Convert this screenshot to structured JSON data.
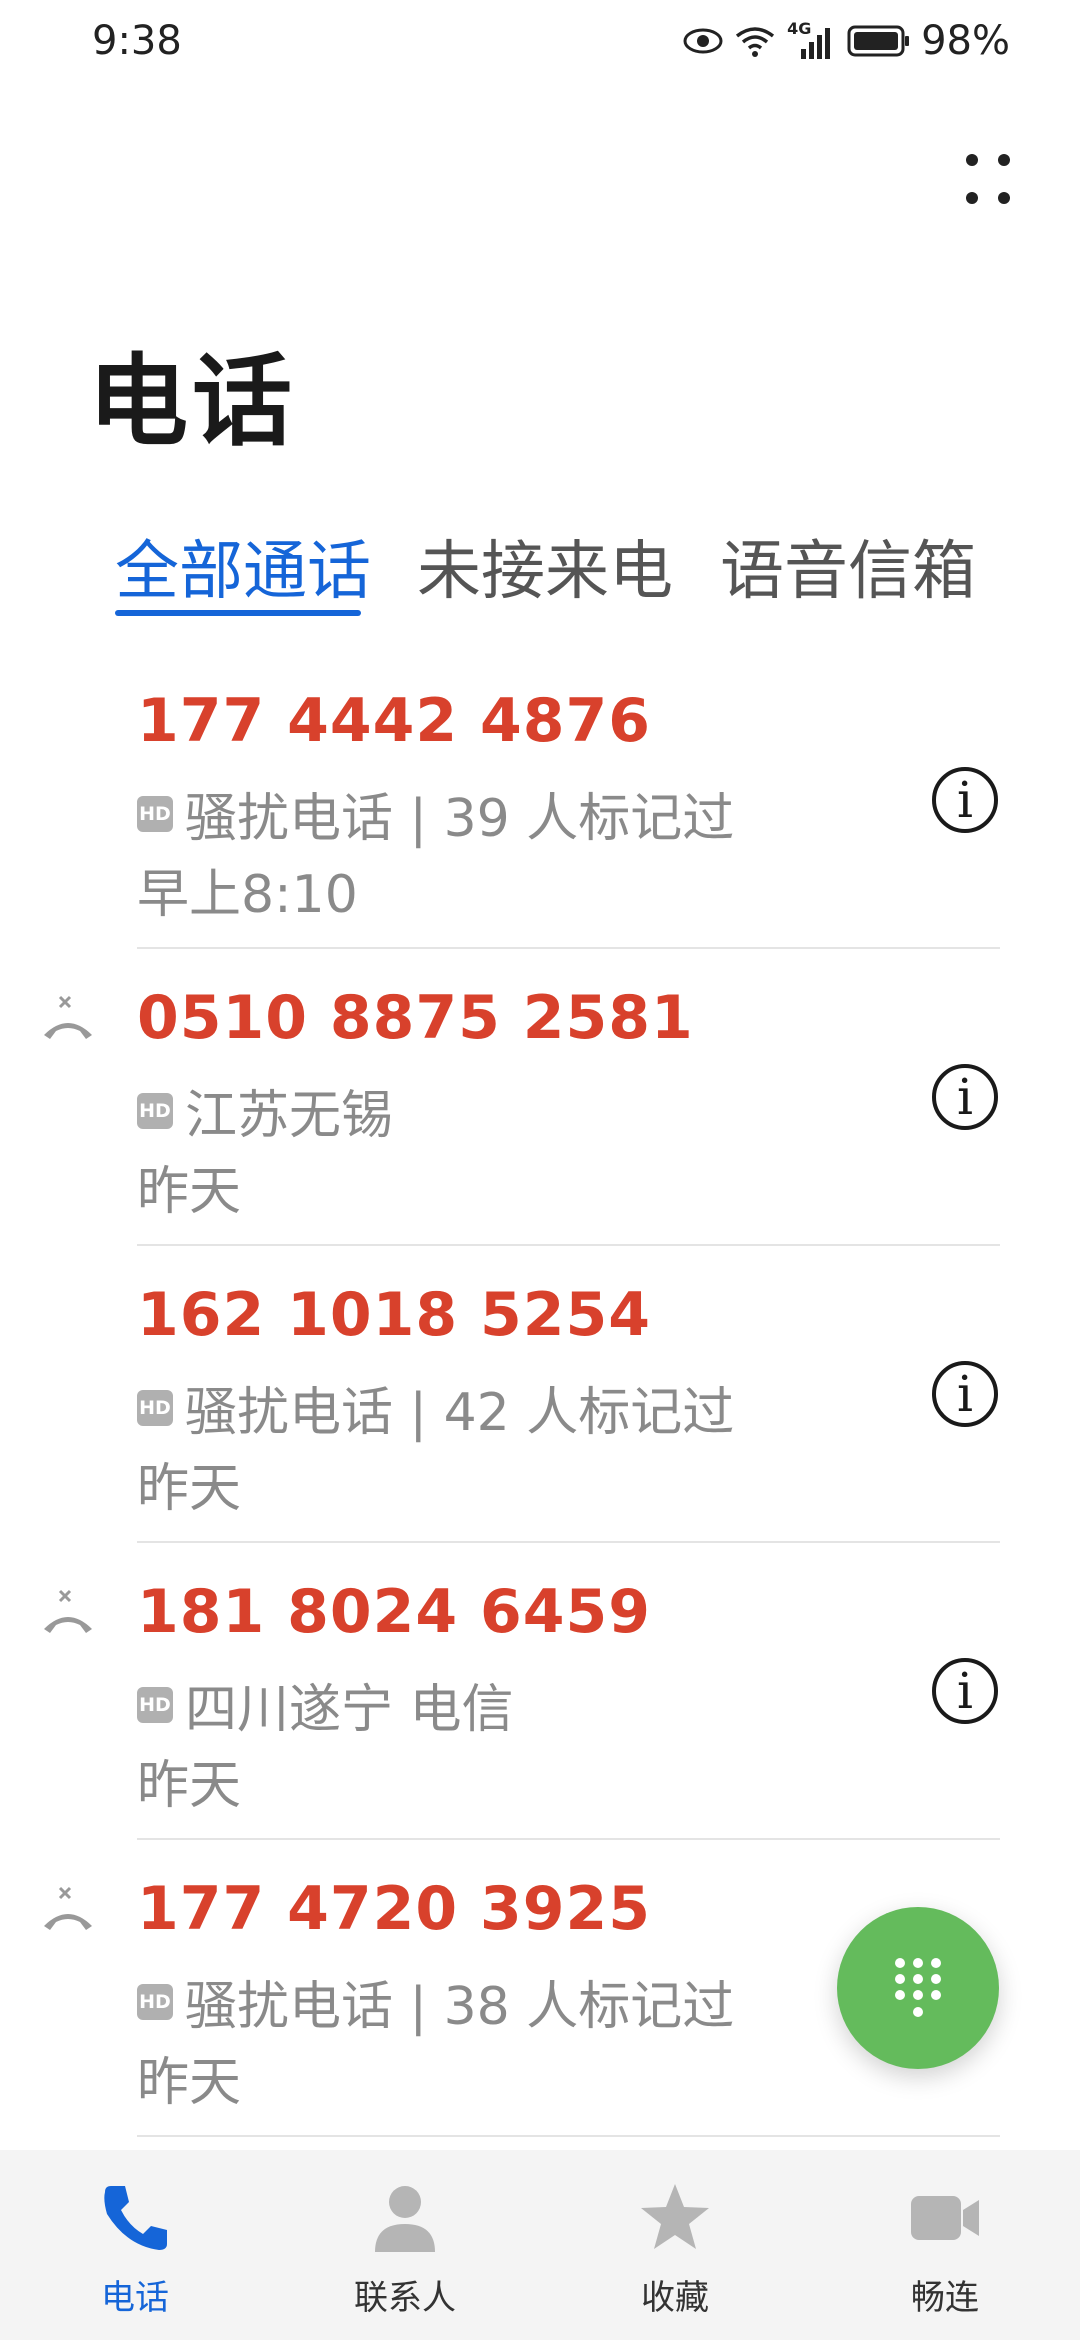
{
  "status_bar": {
    "time": "9:38",
    "network": "4G",
    "battery": "98%"
  },
  "header": {
    "title": "电话"
  },
  "tabs": [
    {
      "label": "全部通话",
      "active": true
    },
    {
      "label": "未接来电",
      "active": false
    },
    {
      "label": "语音信箱",
      "active": false
    }
  ],
  "calls": [
    {
      "number": "177 4442 4876",
      "hd": "HD",
      "detail": "骚扰电话 | 39 人标记过",
      "time": "早上8:10",
      "missed": false
    },
    {
      "number": "0510 8875 2581",
      "hd": "HD",
      "detail": "江苏无锡",
      "time": "昨天",
      "missed": true
    },
    {
      "number": "162 1018 5254",
      "hd": "HD",
      "detail": "骚扰电话 | 42 人标记过",
      "time": "昨天",
      "missed": false
    },
    {
      "number": "181 8024 6459",
      "hd": "HD",
      "detail": "四川遂宁 电信",
      "time": "昨天",
      "missed": true
    },
    {
      "number": "177 4720 3925",
      "hd": "HD",
      "detail": "骚扰电话 | 38 人标记过",
      "time": "昨天",
      "missed": true
    }
  ],
  "bottom_nav": [
    {
      "label": "电话",
      "icon": "phone-icon",
      "active": true
    },
    {
      "label": "联系人",
      "icon": "person-icon",
      "active": false
    },
    {
      "label": "收藏",
      "icon": "star-icon",
      "active": false
    },
    {
      "label": "畅连",
      "icon": "video-icon",
      "active": false
    }
  ],
  "colors": {
    "accent": "#1565d8",
    "number_red": "#d8412c",
    "fab_green": "#64bb5c"
  }
}
